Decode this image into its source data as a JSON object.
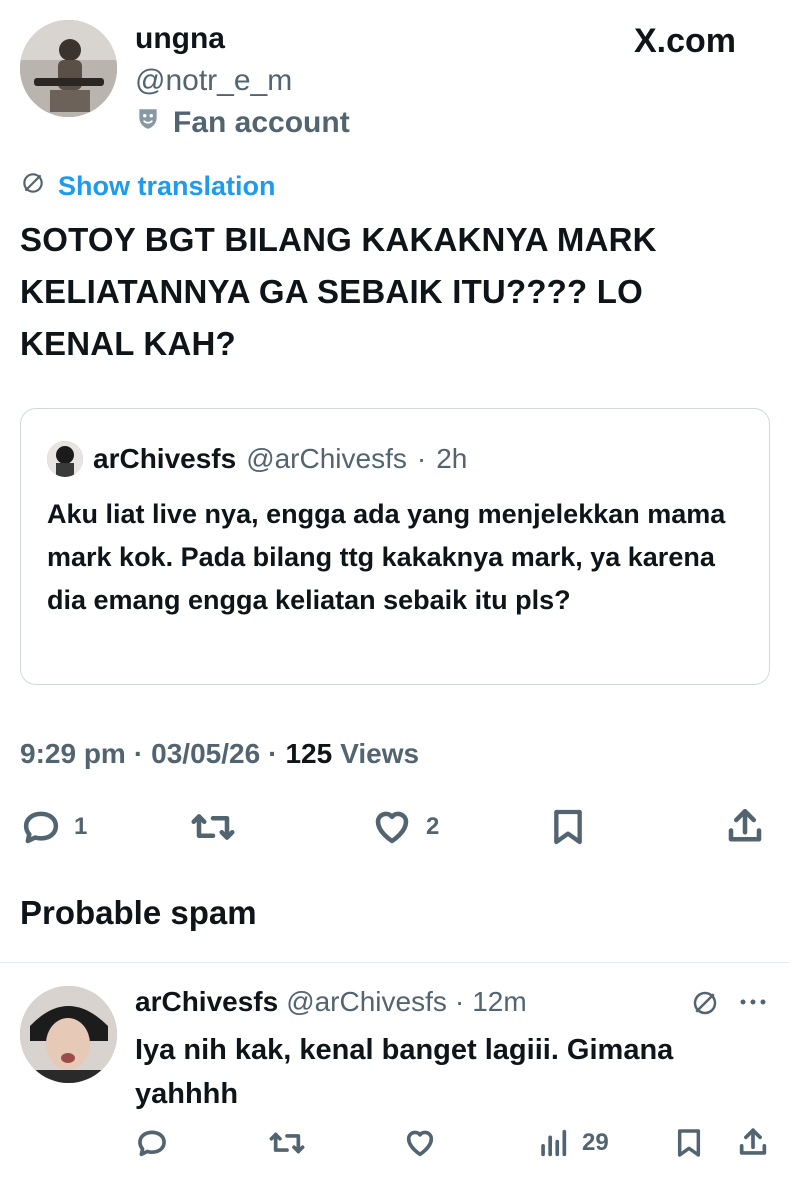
{
  "post": {
    "author_name": "ungna",
    "author_handle": "@notr_e_m",
    "label": "Fan account",
    "brand": "X.com",
    "translation_link": "Show translation",
    "text": "SOTOY BGT BILANG KAKAKNYA MARK KELIATANNYA GA SEBAIK ITU???? LO KENAL KAH?",
    "quote": {
      "author_name": "arChivesfs",
      "author_handle": "@arChivesfs",
      "time": "2h",
      "text": "Aku liat live nya, engga ada yang menjelekkan mama mark kok. Pada bilang ttg kakaknya mark, ya karena dia emang engga keliatan sebaik itu pls?"
    },
    "time": "9:29 pm",
    "date": "03/05/26",
    "views_count": "125",
    "views_label": "Views",
    "separator": "·",
    "reply_count": "1",
    "like_count": "2"
  },
  "section_title": "Probable spam",
  "reply": {
    "author_name": "arChivesfs",
    "author_handle": "@arChivesfs",
    "time": "12m",
    "text": "Iya nih kak, kenal banget lagiii. Gimana yahhhh",
    "views_count": "29"
  },
  "colors": {
    "text": "#0f1419",
    "secondary": "#536471",
    "link": "#1d9bf0",
    "border": "#cfd9de"
  },
  "icons": [
    "translate-icon",
    "mask-icon",
    "reply-icon",
    "retweet-icon",
    "like-icon",
    "bookmark-icon",
    "share-icon",
    "views-icon",
    "more-icon",
    "x-logo-icon"
  ]
}
